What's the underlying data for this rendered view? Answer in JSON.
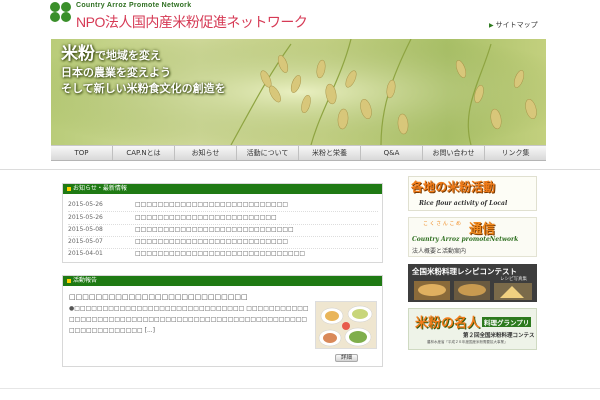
{
  "header": {
    "logo_en": "Country Arroz Promote Network",
    "logo_jp": "NPO法人国内産米粉促進ネットワーク",
    "sitemap": "サイトマップ"
  },
  "banner": {
    "line1_big": "米粉",
    "line1_rest": "で地域を変え",
    "line2": "日本の農業を変えよう",
    "line3": "そして新しい米粉食文化の創造を"
  },
  "nav": {
    "items": [
      "TOP",
      "CAP.Nとは",
      "お知らせ",
      "活動について",
      "米粉と栄養",
      "Q&A",
      "お問い合わせ",
      "リンク集"
    ]
  },
  "news": {
    "heading": "お知らせ・最新情報",
    "rows": [
      {
        "date": "2015-05-26",
        "title": "□□□□□□□□□□□□□□□□□□□□□□□□□□□"
      },
      {
        "date": "2015-05-26",
        "title": "□□□□□□□□□□□□□□□□□□□□□□□□□"
      },
      {
        "date": "2015-05-08",
        "title": "□□□□□□□□□□□□□□□□□□□□□□□□□□□□"
      },
      {
        "date": "2015-05-07",
        "title": "□□□□□□□□□□□□□□□□□□□□□□□□□□□"
      },
      {
        "date": "2015-04-01",
        "title": "□□□□□□□□□□□□□□□□□□□□□□□□□□□□□□"
      }
    ]
  },
  "activity": {
    "heading": "活動報告",
    "title": "□□□□□□□□□□□□□□□□□□□□□□□□□□□",
    "body": "●□□□□□□□□□□□□□□□□□□□□□□□□□□□□□□ □□□□□□□□□□□□□□□□□□□□□□□□□□□□□□□□□□□□□□□□□□□□□□□□□□□□□□□□□□□□□□□□□□ [...]",
    "detail_button": "詳細"
  },
  "side_banners": {
    "b1_title": "各地の米粉活動",
    "b1_sub": "Rice flour activity of Local",
    "b2_small": "こ く さ ん こ め",
    "b2_big": "通信",
    "b2_en": "Country Arroz promoteNetwork",
    "b2_jp": "法人概要と活動案内",
    "b3_title": "全国米粉料理レシピコンテスト",
    "b3_sub": "レシピ写真集",
    "b4_a": "米粉の名人",
    "b4_b": "料理グランプリ",
    "b4_c": "第２回全国米粉料理コンテスト",
    "b4_d": "農林水産省「平成２６年度国産米粉需要拡大事業」"
  },
  "colors": {
    "accent_green": "#1f7a14",
    "logo_red": "#d63a55",
    "orange": "#f07c1a"
  }
}
